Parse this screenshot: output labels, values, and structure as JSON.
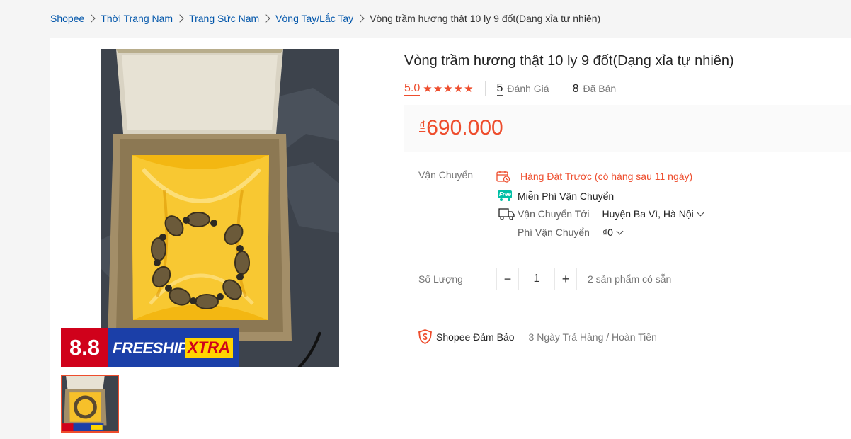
{
  "breadcrumb": [
    {
      "label": "Shopee"
    },
    {
      "label": "Thời Trang Nam"
    },
    {
      "label": "Trang Sức Nam"
    },
    {
      "label": "Vòng Tay/Lắc Tay"
    },
    {
      "label": "Vòng trầm hương thật 10 ly 9 đốt(Dạng xỉa tự nhiên)"
    }
  ],
  "product": {
    "title": "Vòng trầm hương thật 10 ly 9 đốt(Dạng xỉa tự nhiên)",
    "rating": "5.0",
    "stars": 5,
    "ratings_count": "5",
    "ratings_label": "Đánh Giá",
    "sold_count": "8",
    "sold_label": "Đã Bán",
    "currency_symbol": "₫",
    "price": "690.000",
    "banner": {
      "num": "8.8",
      "freeship": "FREESHIP",
      "xtra": "XTRA"
    }
  },
  "shipping": {
    "label": "Vận Chuyển",
    "preorder": "Hàng Đặt Trước (có hàng sau 11 ngày)",
    "free_badge": "Free",
    "free_shipping": "Miễn Phí Vận Chuyển",
    "ship_to_label": "Vận Chuyển Tới",
    "ship_to_value": "Huyện Ba Vì, Hà Nội",
    "fee_label": "Phí Vận Chuyển",
    "fee_value": "₫0"
  },
  "quantity": {
    "label": "Số Lượng",
    "value": "1",
    "decrement": "−",
    "increment": "+",
    "available": "2 sản phẩm có sẵn"
  },
  "guarantee": {
    "label": "Shopee Đảm Bảo",
    "value": "3 Ngày Trả Hàng / Hoàn Tiền"
  },
  "colors": {
    "accent": "#ee4d2d",
    "link": "#0055aa",
    "banner_red": "#d0011b",
    "banner_blue": "#1b3fa8",
    "banner_yellow": "#ffd400"
  }
}
